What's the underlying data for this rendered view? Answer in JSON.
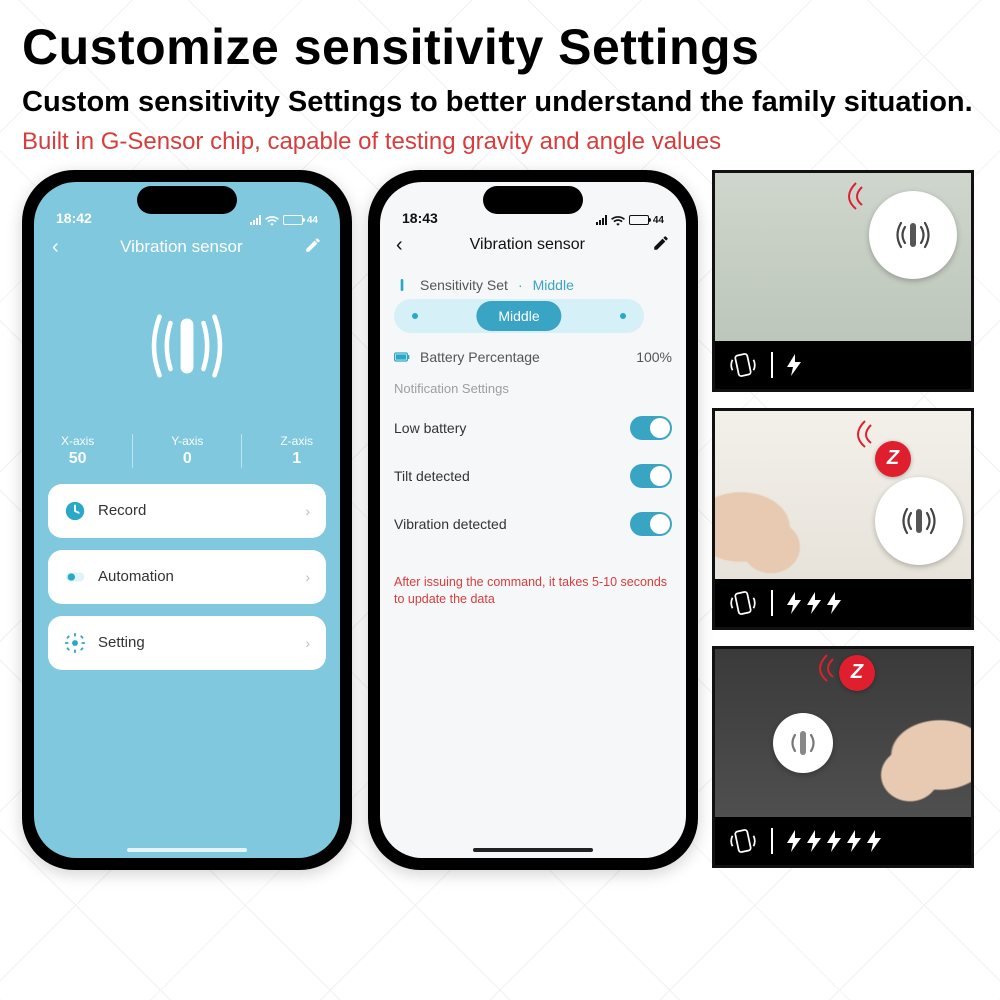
{
  "heading": "Customize sensitivity Settings",
  "subheading": "Custom sensitivity Settings to better understand the family situation.",
  "red_note": "Built in G-Sensor chip, capable of testing gravity and angle values",
  "phone1": {
    "time": "18:42",
    "battery_pct": 44,
    "title": "Vibration sensor",
    "axes": {
      "x": {
        "label": "X-axis",
        "value": "50"
      },
      "y": {
        "label": "Y-axis",
        "value": "0"
      },
      "z": {
        "label": "Z-axis",
        "value": "1"
      }
    },
    "rows": {
      "record": "Record",
      "automation": "Automation",
      "setting": "Setting"
    }
  },
  "phone2": {
    "time": "18:43",
    "battery_pct": 44,
    "title": "Vibration sensor",
    "sensitivity": {
      "label": "Sensitivity Set",
      "value": "Middle",
      "pill": "Middle"
    },
    "battery_row": {
      "label": "Battery Percentage",
      "value": "100%"
    },
    "notif_heading": "Notification Settings",
    "toggles": {
      "low_battery": {
        "label": "Low battery",
        "on": true
      },
      "tilt": {
        "label": "Tilt detected",
        "on": true
      },
      "vibration": {
        "label": "Vibration detected",
        "on": true
      }
    },
    "warn": "After issuing the command, it takes 5-10 seconds to update the data"
  },
  "thumbnails": [
    {
      "bolt_count": 1
    },
    {
      "bolt_count": 3
    },
    {
      "bolt_count": 5
    }
  ]
}
